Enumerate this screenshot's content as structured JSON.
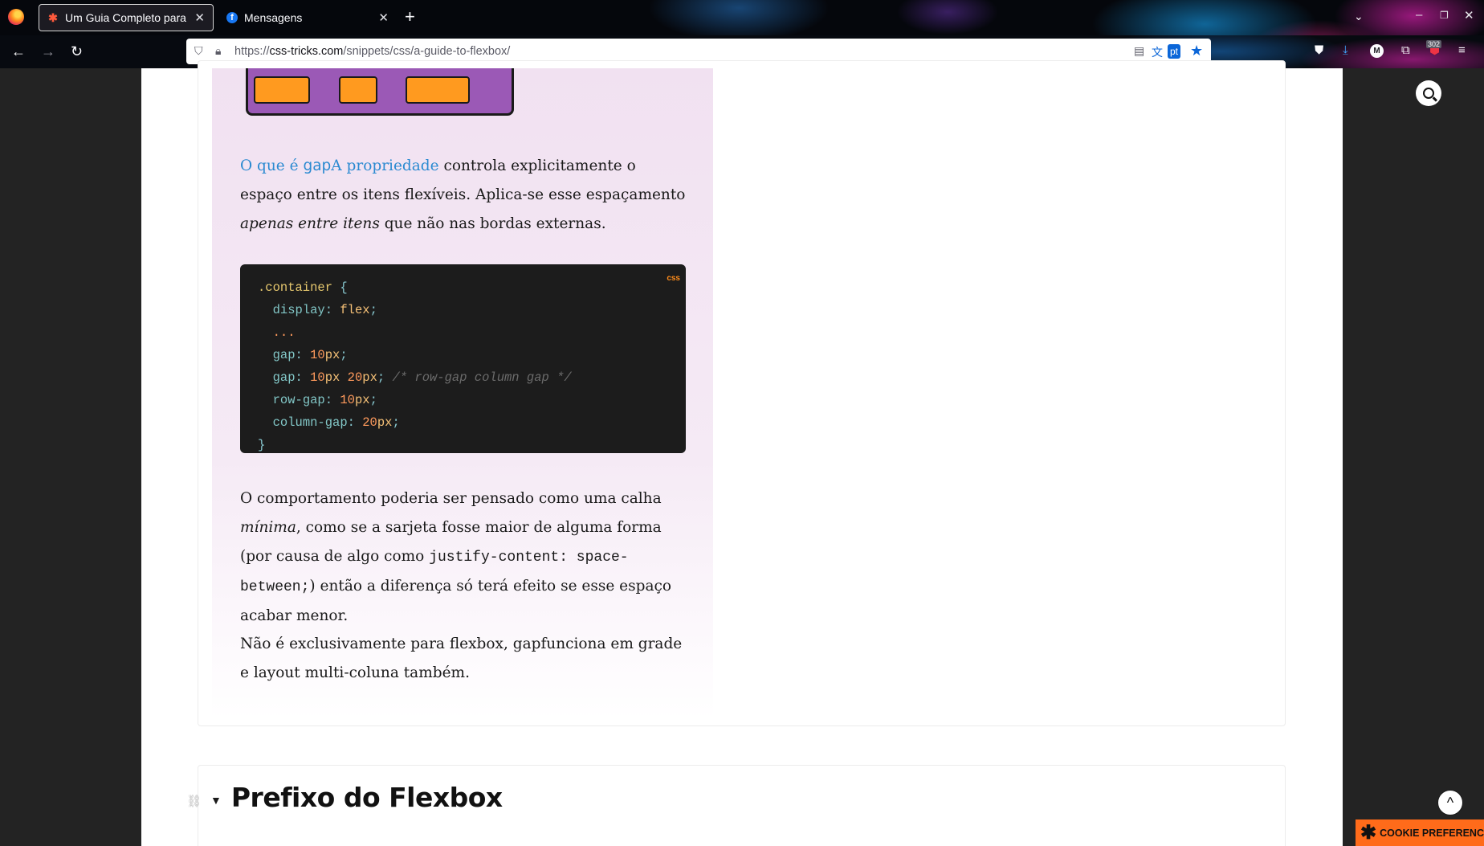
{
  "browser": {
    "tabs": [
      {
        "title": "Um Guia Completo para o Flexbox | CSS-Tricks",
        "favicon": "css-tricks-star-icon",
        "active": true
      },
      {
        "title": "Mensagens",
        "favicon": "facebook-icon",
        "active": false
      }
    ],
    "new_tab_symbol": "+",
    "url_scheme": "https://",
    "url_host": "css-tricks.com",
    "url_path": "/snippets/css/a-guide-to-flexbox/",
    "translate_lang": "pt",
    "account_initial": "M",
    "extension_badge": "302"
  },
  "article": {
    "gap_paragraph": {
      "link_part1": "O que é ",
      "link_code": "gap",
      "link_part2": "A propriedade",
      "text1": " controla explicitamente o espaço entre os itens flexíveis. Aplica-se esse espaçamento ",
      "em": "apenas entre itens",
      "text2": " que não nas bordas externas."
    },
    "code_block": {
      "language": "css",
      "selector": ".container",
      "open_brace": "{",
      "close_brace": "}",
      "lines": [
        {
          "prop": "display",
          "value": "flex"
        },
        {
          "dots": "..."
        },
        {
          "prop": "gap",
          "num1": "10",
          "unit1": "px"
        },
        {
          "prop": "gap",
          "num1": "10",
          "unit1": "px",
          "num2": "20",
          "unit2": "px",
          "comment": "/* row-gap column gap */"
        },
        {
          "prop": "row-gap",
          "num1": "10",
          "unit1": "px"
        },
        {
          "prop": "column-gap",
          "num1": "20",
          "unit1": "px"
        }
      ]
    },
    "behavior_paragraph": {
      "text1": "O comportamento poderia ser pensado como uma calha ",
      "em": "mínima",
      "text2": ", como se a sarjeta fosse maior de alguma forma (por causa de algo como ",
      "code": "justify-content: space-between;",
      "text3": ") então a diferença só terá efeito se esse espaço acabar menor."
    },
    "exclusive_paragraph": {
      "text1": "Não é exclusivamente para flexbox, ",
      "code": "gap",
      "text2": "funciona em grade e layout multi-coluna também."
    },
    "next_section_heading": "Prefixo do Flexbox"
  },
  "widgets": {
    "cookie_label": "COOKIE PREFERENCES",
    "back_to_top_symbol": "^"
  }
}
